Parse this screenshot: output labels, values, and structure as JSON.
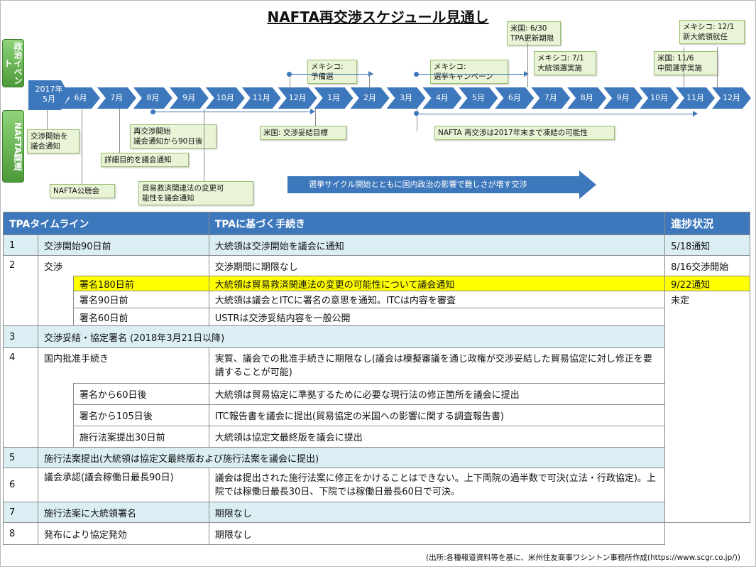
{
  "title": "NAFTA再交渉スケジュール見通し",
  "side_labels": {
    "politics": "政治イベント",
    "nafta": "NAFTA関連"
  },
  "timeline": {
    "first": {
      "year": "2017年",
      "month": "5月"
    },
    "months": [
      "6月",
      "7月",
      "8月",
      "9月",
      "10月",
      "11月",
      "12月",
      "1月",
      "2月",
      "3月",
      "4月",
      "5月",
      "6月",
      "7月",
      "8月",
      "9月",
      "10月",
      "11月",
      "12月"
    ]
  },
  "politics_events": [
    {
      "line1": "メキシコ:",
      "line2": "予備選"
    },
    {
      "line1": "メキシコ:",
      "line2": "選挙キャンペーン"
    },
    {
      "line1": "米国: 6/30",
      "line2": "TPA更新期限"
    },
    {
      "line1": "メキシコ: 7/1",
      "line2": "大統領選実施"
    },
    {
      "line1": "米国: 11/6",
      "line2": "中間選挙実施"
    },
    {
      "line1": "メキシコ: 12/1",
      "line2": "新大統領就任"
    }
  ],
  "nafta_events": [
    {
      "line1": "交渉開始を",
      "line2": "議会通知"
    },
    {
      "line1": "NAFTA公聴会"
    },
    {
      "line1": "詳細目的を議会通知"
    },
    {
      "line1": "再交渉開始",
      "line2": "議会通知から90日後"
    },
    {
      "line1": "貿易救済関連法の変更可",
      "line2": "能性を議会通知"
    },
    {
      "line1": "米国: 交渉妥結目標"
    },
    {
      "line1": "NAFTA 再交渉は2017年末まで凍結の可能性"
    }
  ],
  "banner": "選挙サイクル開始とともに国内政治の影響で難しさが増す交渉",
  "table": {
    "headers": {
      "col1": "TPAタイムライン",
      "col2": "TPAに基づく手続き",
      "col3": "進捗状況"
    },
    "r1": {
      "num": "1",
      "label": "交渉開始90日前",
      "proc": "大統領は交渉開始を議会に通知",
      "status": "5/18通知"
    },
    "r2": {
      "num": "2",
      "label": "交渉",
      "proc": "交渉期間に期限なし",
      "status": "8/16交渉開始"
    },
    "r2a": {
      "label": "署名180日前",
      "proc": "大統領は貿易救済関連法の変更の可能性について議会通知",
      "status": "9/22通知"
    },
    "r2b": {
      "label": "署名90日前",
      "proc": "大統領は議会とITCに署名の意思を通知。ITCは内容を審査",
      "status": "未定"
    },
    "r2c": {
      "label": "署名60日前",
      "proc": "USTRは交渉妥結内容を一般公開"
    },
    "r3": {
      "num": "3",
      "label": "交渉妥結・協定署名 (2018年3月21日以降)"
    },
    "r4": {
      "num": "4",
      "label": "国内批准手続き",
      "proc": "実質、議会での批准手続きに期限なし(議会は模擬審議を通じ政権が交渉妥結した貿易協定に対し修正を要請することが可能)"
    },
    "r4a": {
      "label": "署名から60日後",
      "proc": "大統領は貿易協定に準拠するために必要な現行法の修正箇所を議会に提出"
    },
    "r4b": {
      "label": "署名から105日後",
      "proc": "ITC報告書を議会に提出(貿易協定の米国への影響に関する調査報告書)"
    },
    "r4c": {
      "label": "施行法案提出30日前",
      "proc": "大統領は協定文最終版を議会に提出"
    },
    "r5": {
      "num": "5",
      "label": "施行法案提出(大統領は協定文最終版および施行法案を議会に提出)"
    },
    "r6": {
      "num": "6",
      "label": "議会承認(議会稼働日最長90日)",
      "proc": "議会は提出された施行法案に修正をかけることはできない。上下両院の過半数で可決(立法・行政協定)。上院では稼働日最長30日、下院では稼働日最長60日で可決。"
    },
    "r7": {
      "num": "7",
      "label": "施行法案に大統領署名",
      "proc": "期限なし"
    },
    "r8": {
      "num": "8",
      "label": "発布により協定発効",
      "proc": "期限なし"
    }
  },
  "source": "(出所:各種報道資料等を基に、米州住友商事ワシントン事務所作成(https://www.scgr.co.jp/))"
}
